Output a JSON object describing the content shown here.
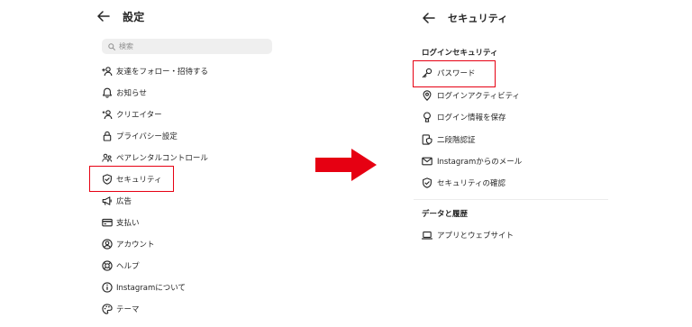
{
  "left": {
    "back_icon": "arrow-left-icon",
    "title": "設定",
    "search": {
      "placeholder": "検索",
      "value": ""
    },
    "items": [
      {
        "label": "友達をフォロー・招待する",
        "icon": "add-person-icon"
      },
      {
        "label": "お知らせ",
        "icon": "bell-icon"
      },
      {
        "label": "クリエイター",
        "icon": "creator-icon"
      },
      {
        "label": "プライバシー設定",
        "icon": "lock-icon"
      },
      {
        "label": "ペアレンタルコントロール",
        "icon": "parental-icon"
      },
      {
        "label": "セキュリティ",
        "icon": "shield-check-icon",
        "highlighted": true
      },
      {
        "label": "広告",
        "icon": "megaphone-icon"
      },
      {
        "label": "支払い",
        "icon": "card-icon"
      },
      {
        "label": "アカウント",
        "icon": "account-icon"
      },
      {
        "label": "ヘルプ",
        "icon": "lifebuoy-icon"
      },
      {
        "label": "Instagramについて",
        "icon": "info-icon"
      },
      {
        "label": "テーマ",
        "icon": "palette-icon"
      }
    ]
  },
  "arrow": {
    "color": "#e60012"
  },
  "right": {
    "back_icon": "arrow-left-icon",
    "title": "セキュリティ",
    "sections": [
      {
        "heading": "ログインセキュリティ",
        "items": [
          {
            "label": "パスワード",
            "icon": "key-icon",
            "highlighted": true
          },
          {
            "label": "ログインアクティビティ",
            "icon": "location-pin-icon"
          },
          {
            "label": "ログイン情報を保存",
            "icon": "keyhole-icon"
          },
          {
            "label": "二段階認証",
            "icon": "phone-shield-icon"
          },
          {
            "label": "Instagramからのメール",
            "icon": "mail-icon"
          },
          {
            "label": "セキュリティの確認",
            "icon": "shield-check-icon"
          }
        ]
      },
      {
        "heading": "データと履歴",
        "items": [
          {
            "label": "アプリとウェブサイト",
            "icon": "laptop-icon"
          }
        ]
      }
    ]
  },
  "colors": {
    "highlight": "#e60012",
    "text": "#262626",
    "search_bg": "#efefef",
    "placeholder": "#8e8e8e"
  }
}
